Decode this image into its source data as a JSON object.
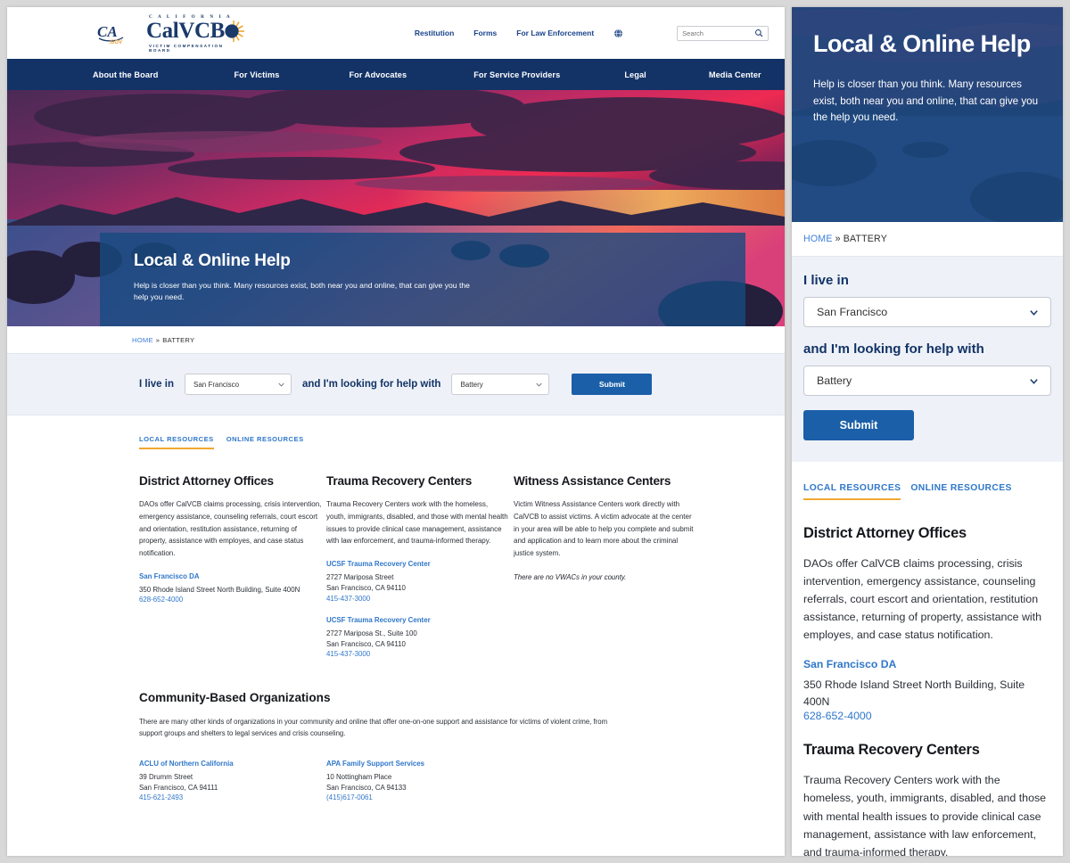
{
  "header": {
    "logo_calvcb_top": "C A L I F O R N I A",
    "logo_calvcb_word": "CalVCB",
    "logo_calvcb_bottom": "VICTIM COMPENSATION BOARD",
    "logo_cagov_alt": "CA.gov",
    "util_links": [
      {
        "label": "Restitution"
      },
      {
        "label": "Forms"
      },
      {
        "label": "For Law Enforcement"
      }
    ],
    "language_icon": "globe-icon",
    "search": {
      "placeholder": "Search",
      "value": "",
      "icon": "search-icon"
    }
  },
  "mainnav": {
    "items": [
      {
        "label": "About the Board"
      },
      {
        "label": "For Victims"
      },
      {
        "label": "For Advocates"
      },
      {
        "label": "For Service Providers"
      },
      {
        "label": "Legal"
      },
      {
        "label": "Media Center"
      }
    ]
  },
  "hero": {
    "title": "Local & Online Help",
    "subtitle": "Help is closer than you think. Many resources exist, both near you and online, that can give you the help you need."
  },
  "breadcrumb": {
    "home": "HOME",
    "separator": "»",
    "current": "BATTERY"
  },
  "filter": {
    "label_live": "I live in",
    "label_help": "and I'm looking for help with",
    "county_value": "San Francisco",
    "crime_value": "Battery",
    "submit_label": "Submit",
    "caret_icon": "chevron-down-icon"
  },
  "tabs": [
    {
      "label": "LOCAL RESOURCES",
      "active": true
    },
    {
      "label": "ONLINE RESOURCES",
      "active": false
    }
  ],
  "columns": [
    {
      "title": "District Attorney Offices",
      "description": "DAOs offer CalVCB claims processing, crisis intervention, emergency assistance, counseling referrals, court escort and orientation, restitution assistance, returning of property, assistance with employes, and case status notification.",
      "entries": [
        {
          "name": "San Francisco DA",
          "address1": "350 Rhode Island Street North Building, Suite 400N",
          "address2": "",
          "phone": "628-652-4000"
        }
      ]
    },
    {
      "title": "Trauma Recovery Centers",
      "description": "Trauma Recovery Centers work with the homeless, youth, immigrants, disabled, and those with mental health issues to provide clinical case management, assistance with law enforcement, and trauma-informed therapy.",
      "entries": [
        {
          "name": "UCSF Trauma Recovery Center",
          "address1": "2727 Mariposa Street",
          "address2": "San Francisco, CA 94110",
          "phone": "415-437-3000"
        },
        {
          "name": "UCSF Trauma Recovery Center",
          "address1": "2727 Mariposa St., Suite 100",
          "address2": "San Francisco, CA 94110",
          "phone": "415-437-3000"
        }
      ]
    },
    {
      "title": "Witness Assistance Centers",
      "description": "Victim Witness Assistance Centers work directly with CalVCB to assist victims. A victim advocate at the center in your area will be able to help you complete and submit and application and to learn more about the criminal justice system.",
      "note": "There are no VWACs in your county.",
      "entries": []
    }
  ],
  "cbo": {
    "title": "Community-Based Organizations",
    "description": "There are many other kinds of organizations in your community and online that offer one-on-one support and assistance for victims of violent crime, from support groups and shelters to legal services and crisis counseling.",
    "entries": [
      {
        "name": "ACLU of Northern California",
        "address1": "39 Drumm Street",
        "address2": "San Francisco, CA 94111",
        "phone": "415-621-2493"
      },
      {
        "name": "APA Family Support Services",
        "address1": "10 Nottingham Place",
        "address2": "San Francisco, CA 94133",
        "phone": "(415)617-0061"
      }
    ]
  },
  "colors": {
    "navy": "#133367",
    "link_blue": "#2f77c9",
    "button_blue": "#1b5fa8",
    "tab_underline": "#f0a830",
    "filter_bg": "#eef2f8"
  }
}
